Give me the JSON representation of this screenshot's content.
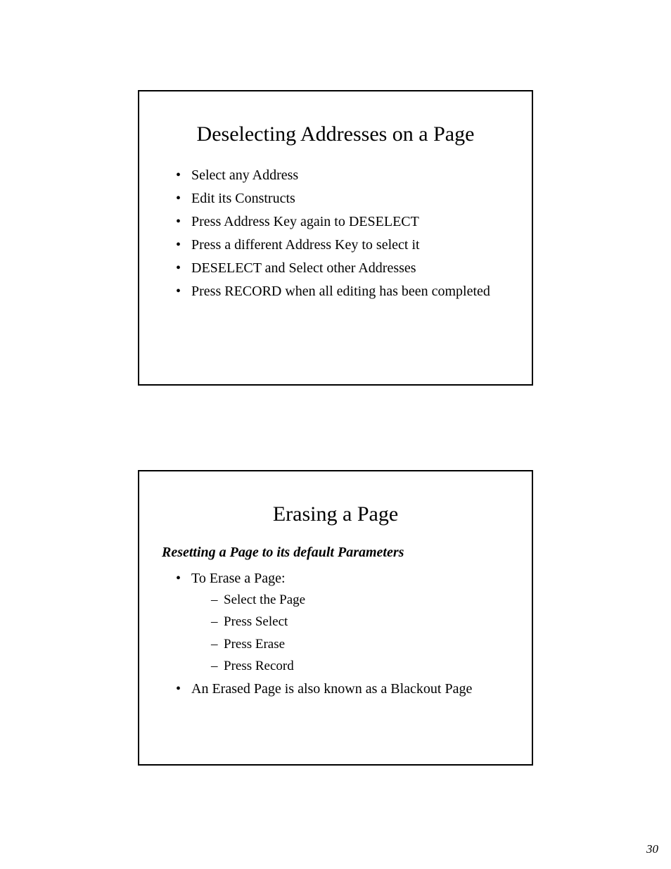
{
  "pageNumber": "30",
  "slides": [
    {
      "title": "Deselecting Addresses on a Page",
      "bullets": [
        "Select any Address",
        "Edit its Constructs",
        "Press Address Key again to DESELECT",
        "Press a different Address Key to select it",
        "DESELECT and Select other Addresses",
        "Press RECORD when all editing has been completed"
      ]
    },
    {
      "title": "Erasing a Page",
      "subtitle": "Resetting a Page to its default Parameters",
      "bullets": [
        {
          "text": "To Erase a Page:",
          "sub": [
            "Select the Page",
            "Press Select",
            "Press Erase",
            "Press Record"
          ]
        },
        {
          "text": "An Erased Page is also known as a Blackout Page"
        }
      ]
    }
  ]
}
